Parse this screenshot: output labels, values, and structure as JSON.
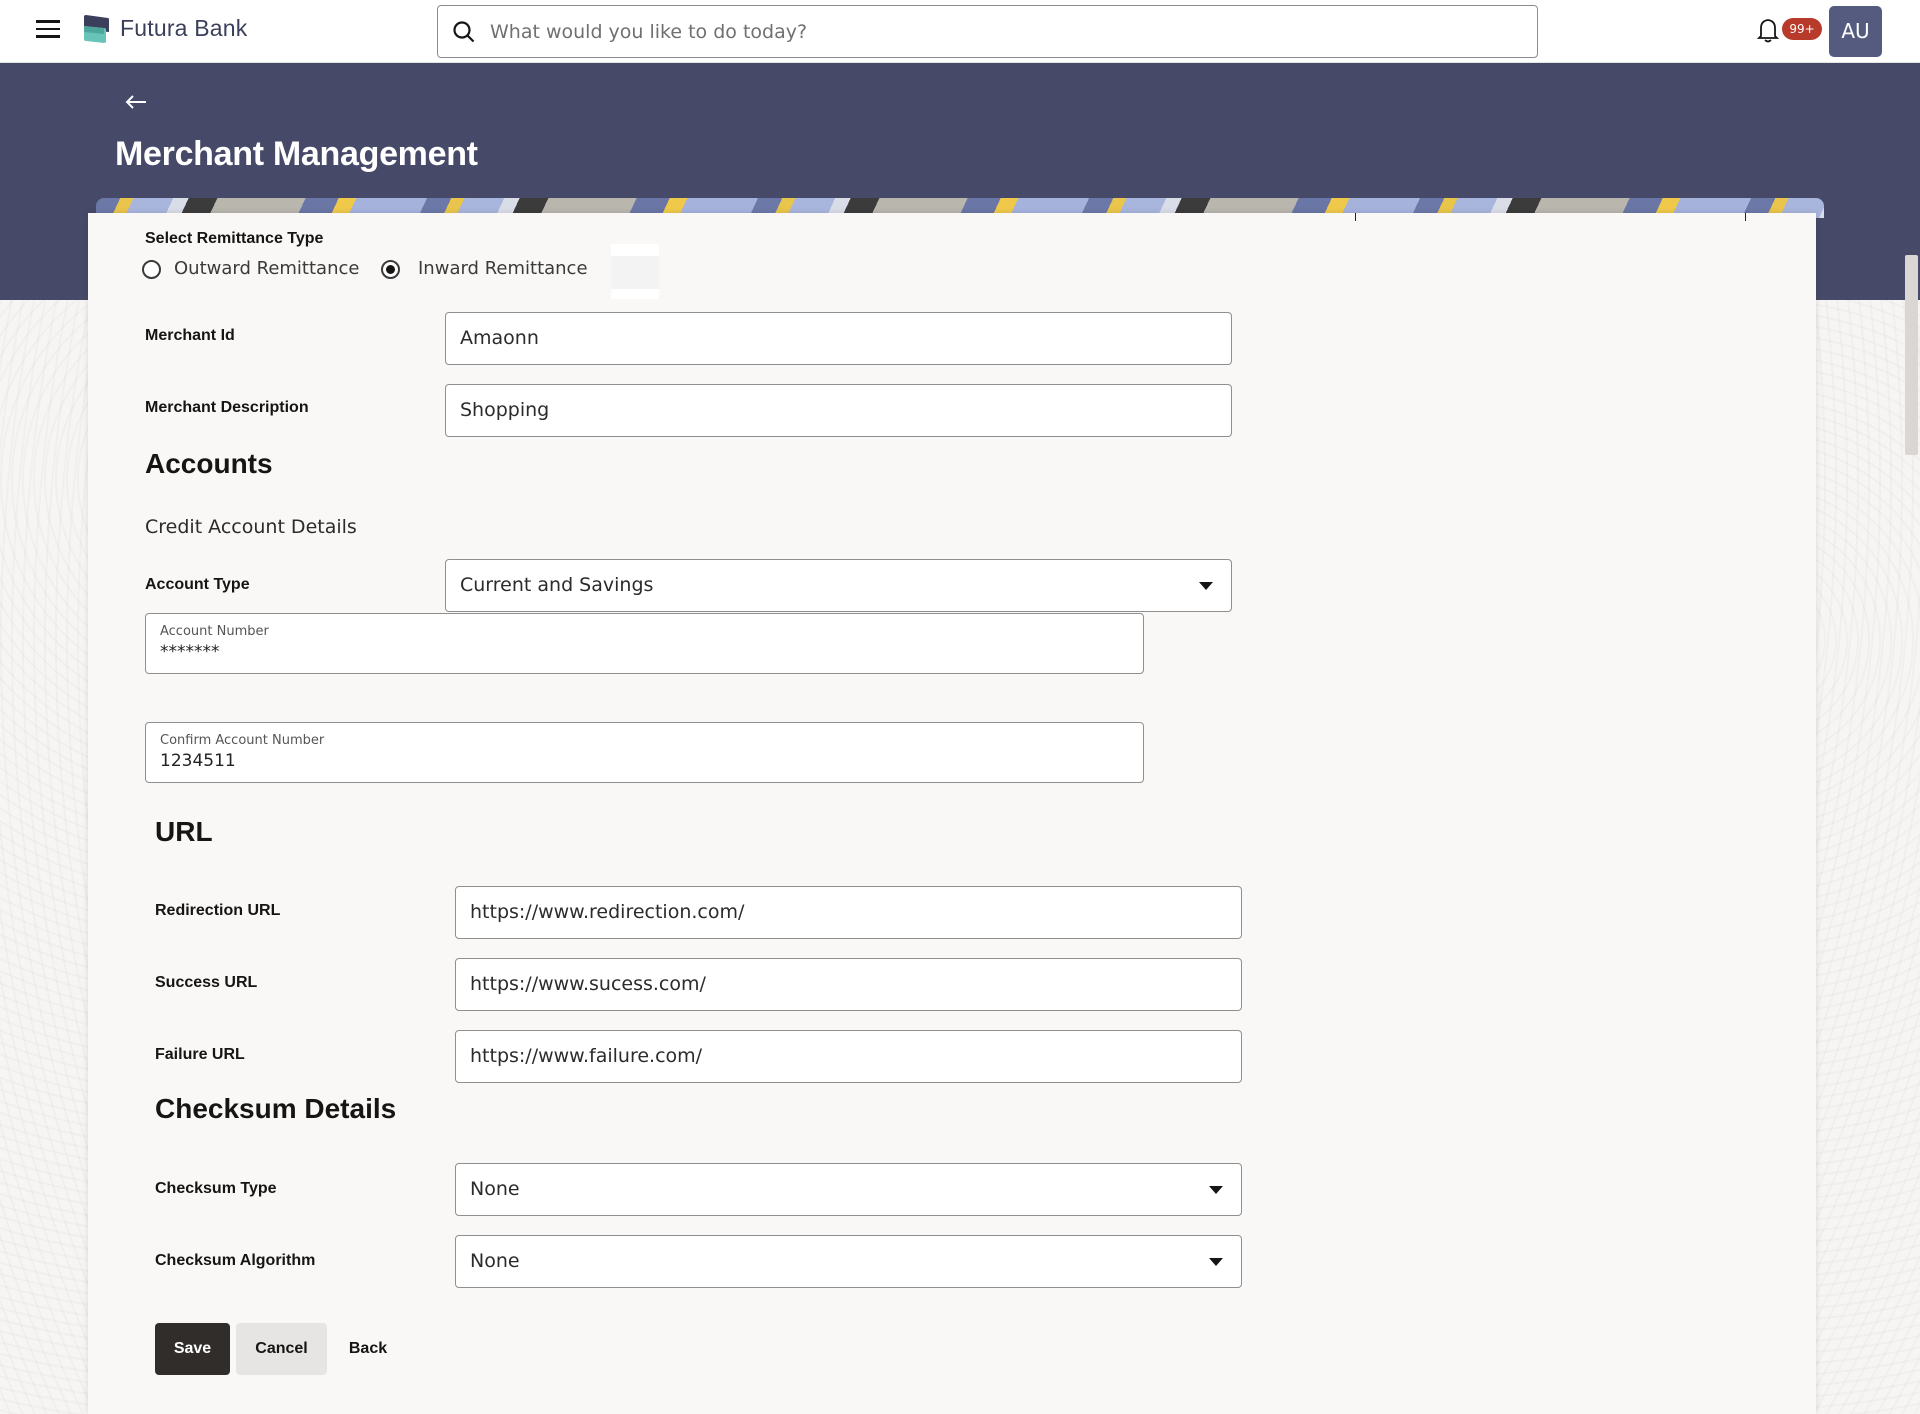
{
  "app": {
    "brand": "Futura Bank",
    "search_placeholder": "What would you like to do today?",
    "notification_count": "99+",
    "user_initials": "AU"
  },
  "page": {
    "title": "Merchant Management"
  },
  "form": {
    "remittance": {
      "label": "Select Remittance Type",
      "options": [
        "Outward Remittance",
        "Inward Remittance"
      ],
      "selected": "Inward Remittance"
    },
    "merchant_id": {
      "label": "Merchant Id",
      "value": "Amaonn"
    },
    "merchant_description": {
      "label": "Merchant Description",
      "value": "Shopping"
    },
    "accounts": {
      "heading": "Accounts",
      "subheading": "Credit Account Details",
      "account_type": {
        "label": "Account Type",
        "value": "Current and Savings"
      },
      "account_number": {
        "label": "Account Number",
        "value": "*******"
      },
      "confirm_account_number": {
        "label": "Confirm Account Number",
        "value": "1234511"
      }
    },
    "url": {
      "heading": "URL",
      "redirection": {
        "label": "Redirection URL",
        "value": "https://www.redirection.com/"
      },
      "success": {
        "label": "Success URL",
        "value": "https://www.sucess.com/"
      },
      "failure": {
        "label": "Failure URL",
        "value": "https://www.failure.com/"
      }
    },
    "checksum": {
      "heading": "Checksum Details",
      "type": {
        "label": "Checksum Type",
        "value": "None"
      },
      "algorithm": {
        "label": "Checksum Algorithm",
        "value": "None"
      }
    },
    "actions": {
      "save": "Save",
      "cancel": "Cancel",
      "back": "Back"
    }
  },
  "colors": {
    "band": "#464a68",
    "avatar": "#555b7e",
    "badge": "#b83a2a",
    "primary_button": "#312d2a"
  }
}
